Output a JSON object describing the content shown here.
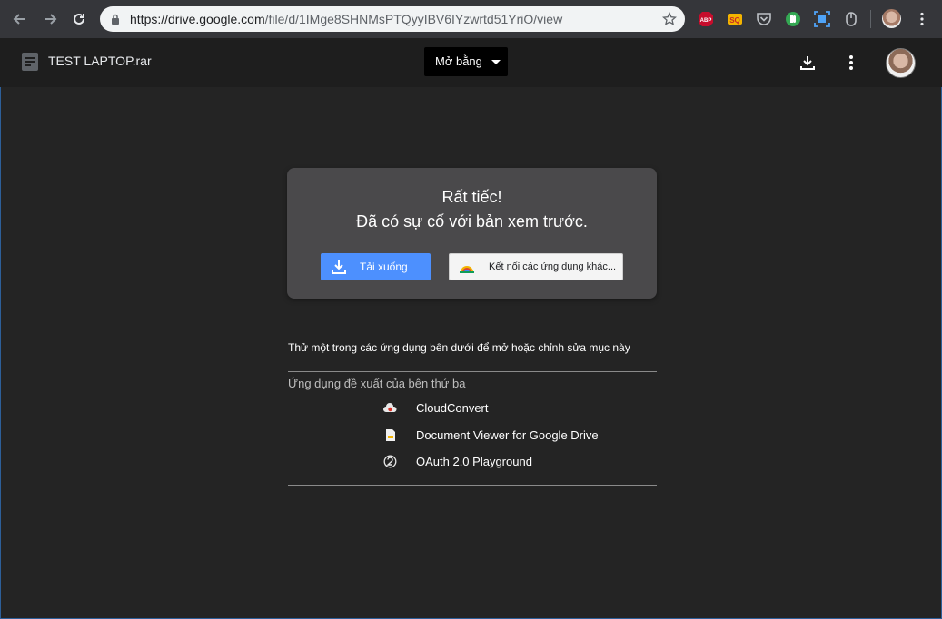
{
  "browser": {
    "url_domain": "https://drive.google.com",
    "url_path": "/file/d/1IMge8SHNMsPTQyyIBV6IYzwrtd51YriO/view",
    "extensions": [
      "abp-icon",
      "sq-icon",
      "pocket-icon",
      "green-circle-icon",
      "screenshot-icon",
      "mouse-icon"
    ],
    "abp_label": "ABP",
    "sq_label": "SQ"
  },
  "viewer": {
    "file_title": "TEST LAPTOP.rar",
    "open_with_label": "Mở bằng"
  },
  "preview_error": {
    "title": "Rất tiếc!",
    "subtitle": "Đã có sự cố với bản xem trước.",
    "download_label": "Tải xuống",
    "connect_label": "Kết nối các ứng dụng khác..."
  },
  "apps": {
    "instruction": "Thử một trong các ứng dụng bên dưới để mở hoặc chỉnh sửa mục này",
    "section_heading": "Ứng dụng đề xuất của bên thứ ba",
    "items": [
      {
        "name": "CloudConvert",
        "icon": "cloudconvert-icon"
      },
      {
        "name": "Document Viewer for Google Drive",
        "icon": "document-viewer-icon"
      },
      {
        "name": "OAuth 2.0 Playground",
        "icon": "oauth-icon"
      }
    ]
  },
  "colors": {
    "download_button": "#4d90fe",
    "card_background": "#4a494b",
    "page_background": "#242424"
  }
}
